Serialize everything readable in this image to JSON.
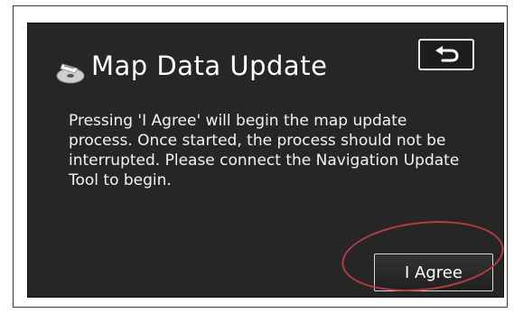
{
  "dialog": {
    "title": "Map Data Update",
    "title_icon": "disc-icon",
    "back_icon": "return-arrow-icon",
    "message": "Pressing 'I Agree' will begin the map update process. Once started, the process should not be interrupted. Please connect the Navigation Update Tool to begin.",
    "agree_label": "I Agree"
  },
  "colors": {
    "screen_background": "#262626",
    "text": "#ffffff",
    "highlight": "#b43a44"
  }
}
